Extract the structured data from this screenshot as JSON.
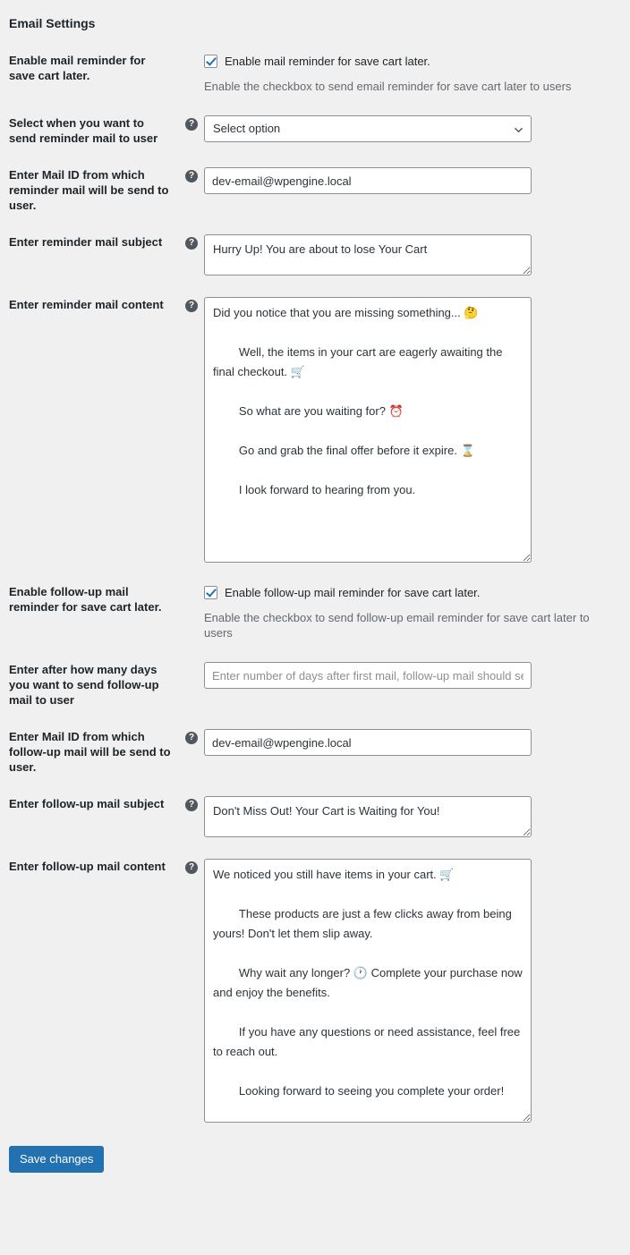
{
  "section": {
    "title": "Email Settings"
  },
  "colors": {
    "page_background": "#f0f0f1",
    "text": "#1d2327",
    "muted_text": "#646970",
    "accent": "#2271b1",
    "border": "#8c8f94",
    "field_background": "#ffffff",
    "help_icon_background": "#50575e"
  },
  "rows": {
    "enable_reminder": {
      "label": "Enable mail reminder for save cart later.",
      "checkbox_label": "Enable mail reminder for save cart later.",
      "checked": true,
      "description": "Enable the checkbox to send email reminder for save cart later to users"
    },
    "send_when": {
      "label": "Select when you want to send reminder mail to user",
      "help": "?",
      "selected": "Select option"
    },
    "reminder_from_mail": {
      "label": "Enter Mail ID from which reminder mail will be send to user.",
      "help": "?",
      "value": "dev-email@wpengine.local"
    },
    "reminder_subject": {
      "label": "Enter reminder mail subject",
      "help": "?",
      "value": "Hurry Up! You are about to lose Your Cart"
    },
    "reminder_content": {
      "label": "Enter reminder mail content",
      "help": "?",
      "value": "Did you notice that you are missing something... 🤔\n\n\tWell, the items in your cart are eagerly awaiting the final checkout. 🛒\n\n\tSo what are you waiting for? ⏰\n\n\tGo and grab the final offer before it expire. ⌛\n\n\tI look forward to hearing from you."
    },
    "enable_followup": {
      "label": "Enable follow-up mail reminder for save cart later.",
      "checkbox_label": "Enable follow-up mail reminder for save cart later.",
      "checked": true,
      "description": "Enable the checkbox to send follow-up email reminder for save cart later to users"
    },
    "followup_days": {
      "label": "Enter after how many days you want to send follow-up mail to user",
      "value": "",
      "placeholder": "Enter number of days after first mail, follow-up mail should send to user"
    },
    "followup_from_mail": {
      "label": "Enter Mail ID from which follow-up mail will be send to user.",
      "help": "?",
      "value": "dev-email@wpengine.local"
    },
    "followup_subject": {
      "label": "Enter follow-up mail subject",
      "help": "?",
      "value": "Don't Miss Out! Your Cart is Waiting for You!"
    },
    "followup_content": {
      "label": "Enter follow-up mail content",
      "help": "?",
      "value": "We noticed you still have items in your cart. 🛒\n\n\tThese products are just a few clicks away from being yours! Don't let them slip away.\n\n\tWhy wait any longer? 🕐 Complete your purchase now and enjoy the benefits.\n\n\tIf you have any questions or need assistance, feel free to reach out.\n\n\tLooking forward to seeing you complete your order!"
    }
  },
  "submit": {
    "label": "Save changes"
  }
}
